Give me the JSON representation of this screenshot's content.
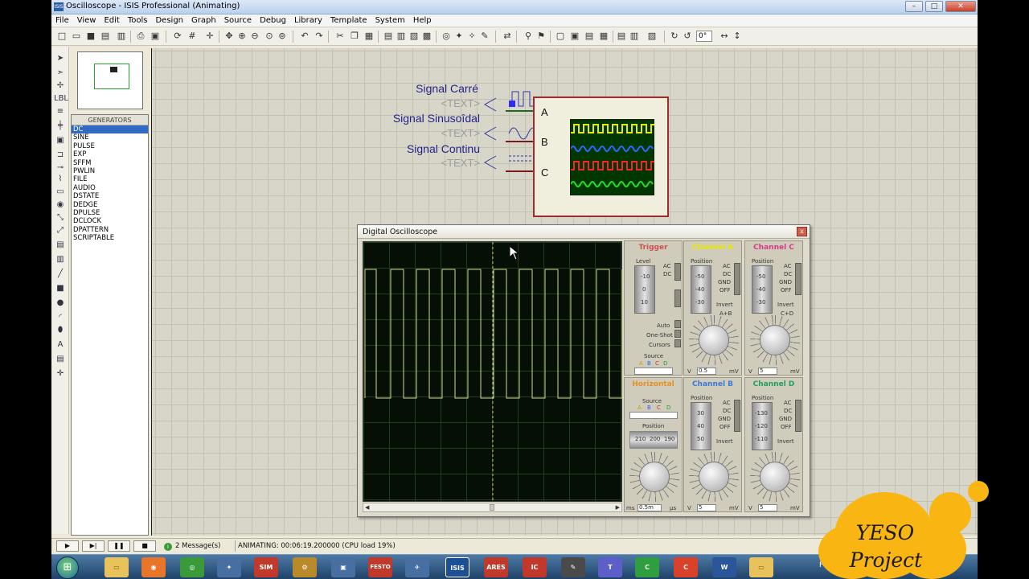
{
  "window": {
    "title": "Oscilloscope - ISIS Professional (Animating)",
    "app_icon": "ISIS",
    "controls": [
      "–",
      "□",
      "✕"
    ]
  },
  "menu": [
    "File",
    "View",
    "Edit",
    "Tools",
    "Design",
    "Graph",
    "Source",
    "Debug",
    "Library",
    "Template",
    "System",
    "Help"
  ],
  "toolbar": {
    "zoom_value": "0°"
  },
  "generators": {
    "header": "GENERATORS",
    "items": [
      "DC",
      "SINE",
      "PULSE",
      "EXP",
      "SFFM",
      "PWLIN",
      "FILE",
      "AUDIO",
      "DSTATE",
      "DEDGE",
      "DPULSE",
      "DCLOCK",
      "DPATTERN",
      "SCRIPTABLE"
    ],
    "selected": "DC"
  },
  "schematic": {
    "signals": [
      {
        "label": "Signal Carré",
        "text": "<TEXT>"
      },
      {
        "label": "Signal Sinusoîdal",
        "text": "<TEXT>"
      },
      {
        "label": "Signal Continu",
        "text": "<TEXT>"
      }
    ],
    "pins": [
      "A",
      "B",
      "C"
    ]
  },
  "oscilloscope": {
    "title": "Digital Oscilloscope",
    "close": "x",
    "trigger": {
      "title": "Trigger",
      "level_label": "Level",
      "ac": "AC",
      "dc": "DC",
      "level_ticks": [
        "-10",
        "0",
        "10"
      ],
      "auto": "Auto",
      "one_shot": "One-Shot",
      "cursors": "Cursors",
      "source_label": "Source",
      "source_options": [
        "A",
        "B",
        "C",
        "D"
      ]
    },
    "channel_a": {
      "title": "Channel A",
      "position_label": "Position",
      "ticks": [
        "-50",
        "-40",
        "-30"
      ],
      "coupling": [
        "AC",
        "DC",
        "GND",
        "OFF"
      ],
      "invert": "Invert",
      "combine": "A+B",
      "scale_value": "0.5",
      "scale_left": "V",
      "scale_right": "mV"
    },
    "channel_c": {
      "title": "Channel C",
      "position_label": "Position",
      "ticks": [
        "-50",
        "-40",
        "-30"
      ],
      "coupling": [
        "AC",
        "DC",
        "GND",
        "OFF"
      ],
      "invert": "Invert",
      "combine": "C+D",
      "scale_value": "5",
      "scale_left": "V",
      "scale_right": "mV"
    },
    "horizontal": {
      "title": "Horizontal",
      "source_label": "Source",
      "source_options": [
        "A",
        "B",
        "C",
        "D"
      ],
      "position_label": "Position",
      "position_ticks": [
        "210",
        "200",
        "190"
      ],
      "scale_value": "0.5m",
      "scale_left": "ms",
      "scale_right": "µs"
    },
    "channel_b": {
      "title": "Channel B",
      "position_label": "Position",
      "ticks": [
        "30",
        "40",
        "50"
      ],
      "coupling": [
        "AC",
        "DC",
        "GND",
        "OFF"
      ],
      "invert": "Invert",
      "scale_value": "5",
      "scale_left": "V",
      "scale_right": "mV"
    },
    "channel_d": {
      "title": "Channel D",
      "position_label": "Position",
      "ticks": [
        "-130",
        "-120",
        "-110"
      ],
      "coupling": [
        "AC",
        "DC",
        "GND",
        "OFF"
      ],
      "invert": "Invert",
      "scale_value": "5",
      "scale_left": "V",
      "scale_right": "mV"
    },
    "colors": {
      "channel_a": "#e8e800",
      "channel_b": "#2a6bff",
      "channel_c": "#ff2222",
      "channel_d": "#22e022",
      "trace": "#d8d8a0"
    }
  },
  "status": {
    "messages": "2 Message(s)",
    "animating": "ANIMATING: 00:06:19.200000 (CPU load 19%)"
  },
  "taskbar": {
    "apps": [
      "folder",
      "firefox",
      "chrome",
      "eagle",
      "SIM",
      "pcb",
      "FESTO",
      "compass",
      "ISIS",
      "ARES",
      "IC",
      "tool",
      "teams",
      "codeblocks-green",
      "codeblocks-red",
      "word",
      "explorer"
    ],
    "labels": {
      "sim": "SIM",
      "festo": "FESTO",
      "isis": "ISIS",
      "ares": "ARES",
      "ic": "IC",
      "word": "W"
    },
    "lang": "FR"
  },
  "logo": {
    "line1": "YESO",
    "line2": "Project"
  }
}
